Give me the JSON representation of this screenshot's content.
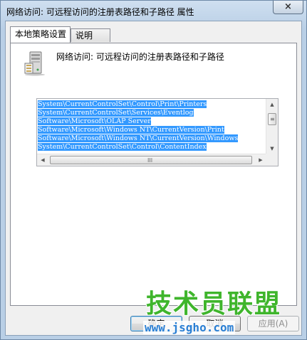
{
  "window": {
    "title": "网络访问: 可远程访问的注册表路径和子路径 属性",
    "close_label": "×"
  },
  "tabs": [
    {
      "label": "本地策略设置",
      "active": true
    },
    {
      "label": "说明",
      "active": false
    }
  ],
  "policy": {
    "icon": "server-computer-icon",
    "title": "网络访问: 可远程访问的注册表路径和子路径"
  },
  "paths": [
    "System\\CurrentControlSet\\Control\\Print\\Printers",
    "System\\CurrentControlSet\\Services\\Eventlog",
    "Software\\Microsoft\\OLAP Server",
    "Software\\Microsoft\\Windows NT\\CurrentVersion\\Print",
    "Software\\Microsoft\\Windows NT\\CurrentVersion\\Windows",
    "System\\CurrentControlSet\\Control\\ContentIndex"
  ],
  "scrollbar": {
    "up": "▲",
    "down": "▼",
    "left": "◀",
    "right": "▶",
    "grip": "≡",
    "hgrip": "III"
  },
  "buttons": {
    "ok": "确定",
    "cancel": "取消",
    "apply": "应用(A)"
  },
  "watermark": {
    "main": "技术员联盟",
    "url": "www.jsgho.com"
  },
  "colors": {
    "selection": "#3399ff",
    "watermark_green": "#3fb52c",
    "watermark_blue": "#2a7fd4"
  }
}
